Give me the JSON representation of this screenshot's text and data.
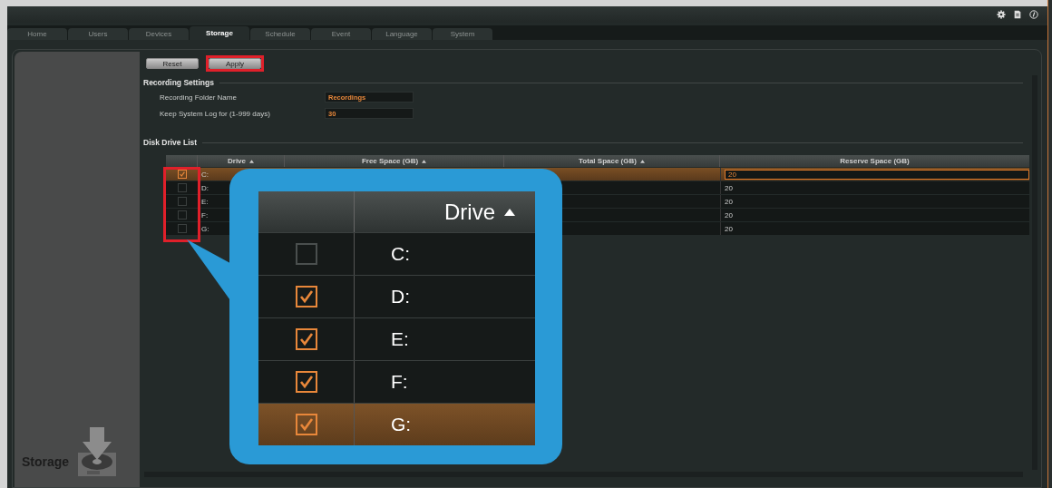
{
  "tabs": [
    {
      "label": "Home",
      "selected": false
    },
    {
      "label": "Users",
      "selected": false
    },
    {
      "label": "Devices",
      "selected": false
    },
    {
      "label": "Storage",
      "selected": true
    },
    {
      "label": "Schedule",
      "selected": false
    },
    {
      "label": "Event",
      "selected": false
    },
    {
      "label": "Language",
      "selected": false
    },
    {
      "label": "System",
      "selected": false
    }
  ],
  "buttons": [
    {
      "label": "Reset",
      "highlighted": false
    },
    {
      "label": "Apply",
      "highlighted": true
    }
  ],
  "recording_settings": {
    "title": "Recording Settings",
    "fields": [
      {
        "label": "Recording Folder Name",
        "value": "Recordings"
      },
      {
        "label": "Keep System Log for (1-999 days)",
        "value": "30"
      }
    ]
  },
  "disk_drive_list": {
    "title": "Disk Drive List",
    "checkbox_column_highlighted": true,
    "columns": [
      {
        "label": "Drive",
        "sortable": true
      },
      {
        "label": "Free Space (GB)",
        "sortable": true
      },
      {
        "label": "Total Space (GB)",
        "sortable": true
      },
      {
        "label": "Reserve Space (GB)",
        "sortable": false
      }
    ],
    "rows": [
      {
        "checked": true,
        "selected": true,
        "drive": "C:",
        "reserve": "20"
      },
      {
        "checked": false,
        "selected": false,
        "drive": "D:",
        "reserve": "20"
      },
      {
        "checked": false,
        "selected": false,
        "drive": "E:",
        "reserve": "20"
      },
      {
        "checked": false,
        "selected": false,
        "drive": "F:",
        "reserve": "20"
      },
      {
        "checked": false,
        "selected": false,
        "drive": "G:",
        "reserve": "20"
      }
    ]
  },
  "callout": {
    "column": "Drive",
    "rows": [
      {
        "checked": false,
        "selected": false,
        "drive": "C:"
      },
      {
        "checked": true,
        "selected": false,
        "drive": "D:"
      },
      {
        "checked": true,
        "selected": false,
        "drive": "E:"
      },
      {
        "checked": true,
        "selected": false,
        "drive": "F:"
      },
      {
        "checked": true,
        "selected": true,
        "drive": "G:"
      }
    ]
  },
  "sidebar": {
    "label": "Storage"
  }
}
